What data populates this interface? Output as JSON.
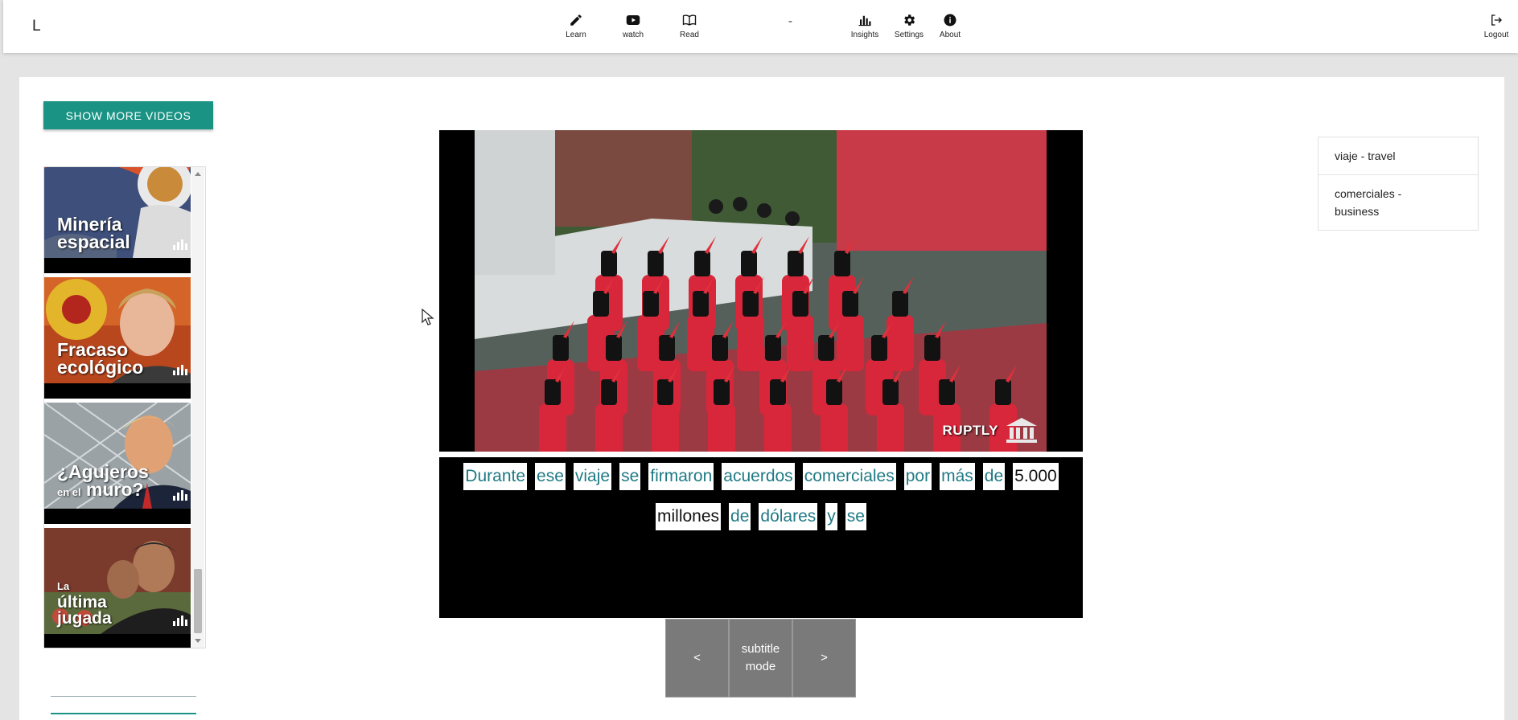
{
  "header": {
    "brand": "L",
    "nav": [
      {
        "id": "learn",
        "label": "Learn",
        "icon": "pencil-icon"
      },
      {
        "id": "watch",
        "label": "watch",
        "icon": "youtube-icon"
      },
      {
        "id": "read",
        "label": "Read",
        "icon": "book-icon"
      },
      {
        "id": "insights",
        "label": "Insights",
        "icon": "bar-chart-icon"
      },
      {
        "id": "settings",
        "label": "Settings",
        "icon": "gear-icon"
      },
      {
        "id": "about",
        "label": "About",
        "icon": "info-icon"
      },
      {
        "id": "logout",
        "label": "Logout",
        "icon": "logout-icon"
      }
    ],
    "separator": "-"
  },
  "sidebar": {
    "more_videos_label": "Show more videos",
    "videos": [
      {
        "line1": "Minería",
        "line2": "espacial",
        "icon": "astronaut-thumbnail"
      },
      {
        "line1": "Fracaso",
        "line2": "ecológico",
        "icon": "merkel-thumbnail"
      },
      {
        "line1": "¿Agujeros",
        "pre": "en el",
        "line2": "muro?",
        "icon": "trump-thumbnail"
      },
      {
        "line1": "La",
        "line2": "última",
        "line3": "jugada",
        "icon": "maduro-thumbnail"
      }
    ]
  },
  "player": {
    "watermark": "RUPTLY"
  },
  "subtitles": {
    "line1": [
      {
        "w": "Durante",
        "known": false
      },
      {
        "w": "ese",
        "known": false
      },
      {
        "w": "viaje",
        "known": false
      },
      {
        "w": "se",
        "known": false
      },
      {
        "w": "firmaron",
        "known": false
      },
      {
        "w": "acuerdos",
        "known": false
      },
      {
        "w": "comerciales",
        "known": false
      },
      {
        "w": "por",
        "known": false
      },
      {
        "w": "más",
        "known": false
      },
      {
        "w": "de",
        "known": false
      },
      {
        "w": "5.000",
        "known": true
      }
    ],
    "line2": [
      {
        "w": "millones",
        "known": true
      },
      {
        "w": "de",
        "known": false
      },
      {
        "w": "dólares",
        "known": false
      },
      {
        "w": "y",
        "known": false
      },
      {
        "w": "se",
        "known": false
      }
    ]
  },
  "controls": {
    "prev": "<",
    "mode": "subtitle mode",
    "next": ">"
  },
  "vocab": [
    {
      "label": "viaje - travel"
    },
    {
      "label": "comerciales - business"
    }
  ],
  "colors": {
    "accent": "#1a9384",
    "word_text": "#1f7a84",
    "control_bg": "#7a7a7a"
  }
}
